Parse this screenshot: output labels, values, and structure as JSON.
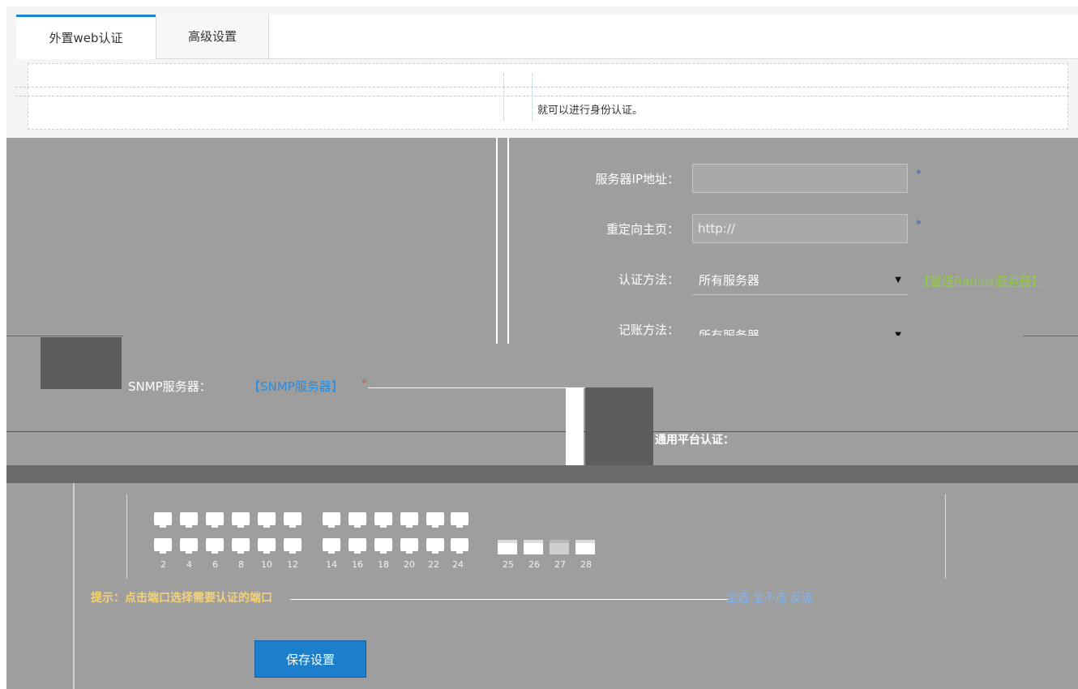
{
  "tabs": [
    {
      "label": "外置web认证",
      "active": true
    },
    {
      "label": "高级设置",
      "active": false
    }
  ],
  "notice": {
    "text": "就可以进行身份认证。"
  },
  "form": {
    "server_ip_label": "服务器IP地址：",
    "server_ip_value": "",
    "redirect_label": "重定向主页：",
    "redirect_value": "http://",
    "auth_method_label": "认证方法：",
    "auth_method_value": "所有服务器",
    "manage_radius_link": "【管理Radius服务器】",
    "acct_method_label": "记账方法：",
    "acct_method_value": "所有服务器",
    "snmp_label": "SNMP服务器：",
    "snmp_link": "【SNMP服务器】",
    "required_mark": "*",
    "platform_label": "通用平台认证："
  },
  "ports": {
    "bottom_labels": [
      "2",
      "4",
      "6",
      "8",
      "10",
      "12",
      "14",
      "16",
      "18",
      "20",
      "22",
      "24",
      "25",
      "26",
      "27",
      "28"
    ]
  },
  "legend": {
    "left_text": "提示：点击端口选择需要认证的端口",
    "right_text": "全选  全不选  反选"
  },
  "actions": {
    "save_label": "保存设置"
  },
  "colors": {
    "accent": "#1d86d3",
    "link": "#93c74a",
    "button": "#1b7fcc"
  }
}
